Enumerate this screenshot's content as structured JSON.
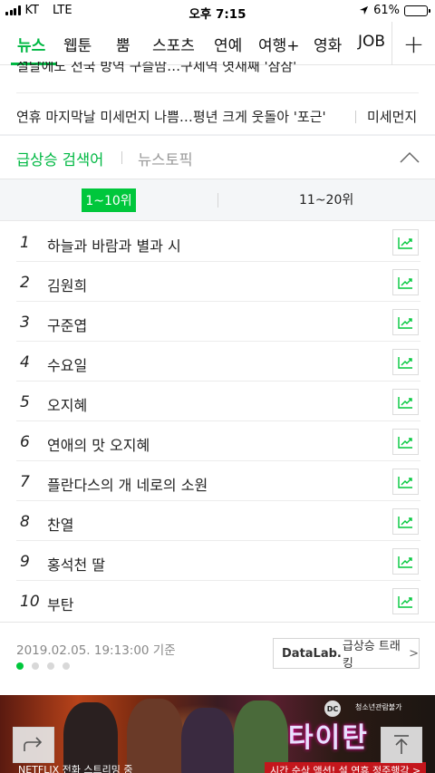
{
  "status_bar": {
    "carrier": "KT",
    "network": "LTE",
    "time": "오후 7:15",
    "battery_percent": "61%",
    "battery_level": 0.61
  },
  "nav": {
    "tabs": [
      {
        "label": "뉴스",
        "active": true
      },
      {
        "label": "웹툰",
        "active": false
      },
      {
        "label": "뿜",
        "active": false
      },
      {
        "label": "스포츠",
        "active": false
      },
      {
        "label": "연예",
        "active": false
      },
      {
        "label": "여행+",
        "active": false
      },
      {
        "label": "영화",
        "active": false
      },
      {
        "label": "JOB",
        "active": false
      }
    ],
    "more_label": "+"
  },
  "headlines": {
    "item1": "설날에도 전국 방역 구슬땀…구제역 엿새째 '잠잠'",
    "item2": "연휴 마지막날 미세먼지 나쁨…평년 크게 웃돌아 '포근'",
    "item2_keyword": "미세먼지"
  },
  "section": {
    "tab_realtime": "급상승 검색어",
    "tab_topic": "뉴스토픽"
  },
  "range_tabs": {
    "first": "1~10위",
    "second": "11~20위"
  },
  "ranking": [
    {
      "rank": "1",
      "keyword": "하늘과 바람과 별과 시"
    },
    {
      "rank": "2",
      "keyword": "김원희"
    },
    {
      "rank": "3",
      "keyword": "구준엽"
    },
    {
      "rank": "4",
      "keyword": "수요일"
    },
    {
      "rank": "5",
      "keyword": "오지혜"
    },
    {
      "rank": "6",
      "keyword": "연애의 맛 오지혜"
    },
    {
      "rank": "7",
      "keyword": "플란다스의 개 네로의 소원"
    },
    {
      "rank": "8",
      "keyword": "찬열"
    },
    {
      "rank": "9",
      "keyword": "홍석천 딸"
    },
    {
      "rank": "10",
      "keyword": "부탄"
    }
  ],
  "footer": {
    "timestamp": "2019.02.05. 19:13:00 기준",
    "datalab_brand": "DataLab.",
    "datalab_label": "급상승 트래킹",
    "datalab_chevron": ">",
    "page_dots": 4,
    "active_dot": 0
  },
  "ad": {
    "title": "타이탄",
    "rating": "청소년관람불가",
    "badge": "DC",
    "tagline": "시간 순삭 액션! 설 연휴 정주행각 >",
    "platform": "NETFLIX  전화 스트리밍 중"
  },
  "colors": {
    "accent": "#00c73c",
    "accent_text": "#00b843"
  }
}
